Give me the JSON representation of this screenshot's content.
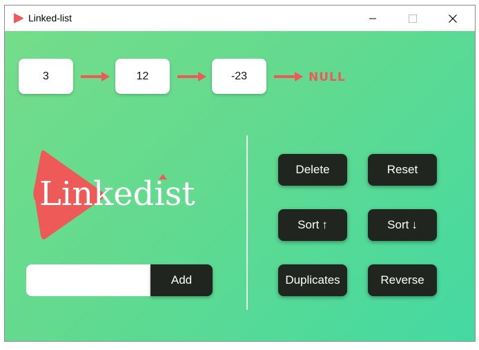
{
  "window": {
    "title": "Linked-list",
    "controls": {
      "minimize_icon": "minimize-icon",
      "maximize_icon": "maximize-icon",
      "close_icon": "close-icon"
    }
  },
  "list": {
    "nodes": [
      "3",
      "12",
      "-23"
    ],
    "terminator": "NULL",
    "arrow_color": "#ee5a58"
  },
  "logo": {
    "text": "Linkedist",
    "icon": "play-triangle-icon",
    "color": "#ee5a58"
  },
  "add_form": {
    "input_value": "",
    "input_placeholder": "",
    "button_label": "Add"
  },
  "actions": {
    "delete": "Delete",
    "reset": "Reset",
    "sort_asc": "Sort",
    "sort_asc_arrow": "↑",
    "sort_desc": "Sort",
    "sort_desc_arrow": "↓",
    "duplicates": "Duplicates",
    "reverse": "Reverse"
  },
  "colors": {
    "button_bg": "#20251f",
    "accent": "#ee5a58",
    "background_start": "#74dd8a",
    "background_end": "#44d9a2"
  }
}
